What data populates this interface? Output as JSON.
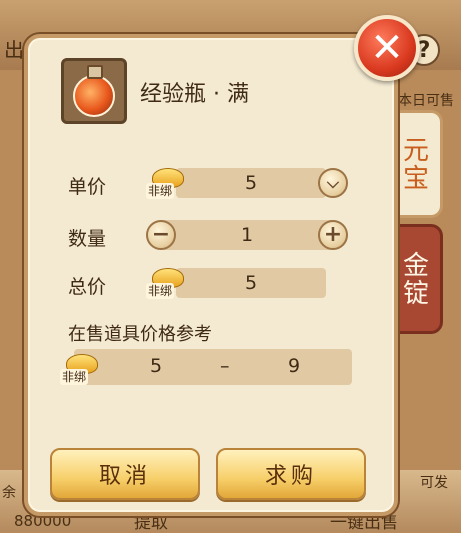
{
  "background": {
    "top_left_fragment": "出",
    "top_right_fragment": "本日可售",
    "help_glyph": "?",
    "bottom_left_fragment": "余",
    "bottom_left_value": "880000",
    "bottom_mid_fragment": "提取",
    "bottom_right_fragment": "一键出售",
    "bottom_right_top": "可发"
  },
  "dialog": {
    "close_glyph": "✕",
    "tabs": [
      {
        "label": "元宝",
        "active": true
      },
      {
        "label": "金锭",
        "active": false
      }
    ],
    "item": {
      "icon": "potion-bottle-icon",
      "name": "经验瓶 · 满"
    },
    "unit_price": {
      "label": "单价",
      "badge": "非绑",
      "value": "5"
    },
    "quantity": {
      "label": "数量",
      "value": "1",
      "minus": "−",
      "plus": "+"
    },
    "total_price": {
      "label": "总价",
      "badge": "非绑",
      "value": "5"
    },
    "reference": {
      "title": "在售道具价格参考",
      "badge": "非绑",
      "min": "5",
      "dash": "–",
      "max": "9"
    },
    "buttons": {
      "cancel": "取消",
      "request_buy": "求购"
    }
  },
  "colors": {
    "accent": "#c95d1d",
    "tab_inactive": "#a84732",
    "button": "#f7cf6a"
  }
}
